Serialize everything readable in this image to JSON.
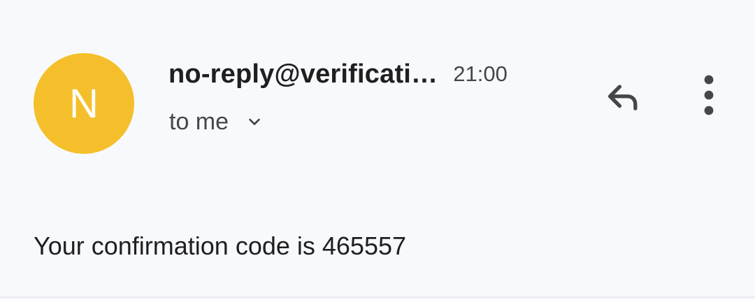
{
  "email": {
    "avatar_initial": "N",
    "avatar_color": "#f4bf2a",
    "sender": "no-reply@verificati…",
    "time": "21:00",
    "recipient_label": "to me",
    "icons": {
      "expand_recipients": "chevron-down-icon",
      "reply": "reply-icon",
      "more": "more-vertical-icon"
    },
    "body": "Your confirmation code is 465557"
  }
}
